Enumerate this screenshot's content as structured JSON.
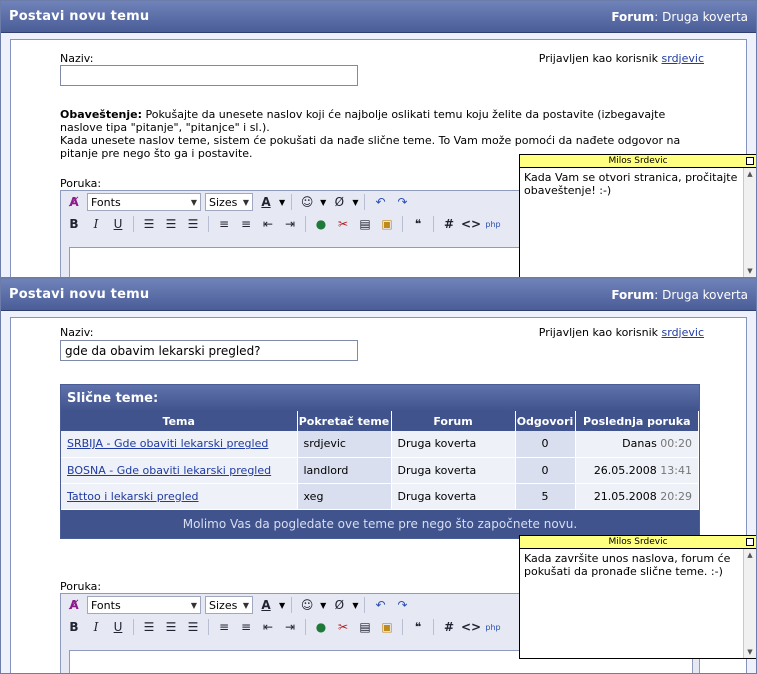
{
  "panel1": {
    "title": "Postavi novu temu",
    "crumb_label": "Forum",
    "crumb_value": ": Druga koverta",
    "name_label": "Naziv:",
    "name_value": "",
    "logged_text": "Prijavljen kao korisnik",
    "username": "srdjevic",
    "notice_bold": "Obaveštenje:",
    "notice_text": " Pokušajte da unesete naslov koji će najbolje oslikati temu koju želite da postavite (izbegavajte naslove tipa \"pitanje\", \"pitanjce\" i sl.).",
    "notice_text2": "Kada unesete naslov teme, sistem će pokušati da nađe slične teme. To Vam može pomoći da nađete odgovor na pitanje pre nego što ga i postavite.",
    "message_label": "Poruka:",
    "note": {
      "author": "Milos Srdevic",
      "text": "Kada Vam se otvori stranica, pročitajte obaveštenje! :-)"
    }
  },
  "panel2": {
    "title": "Postavi novu temu",
    "crumb_label": "Forum",
    "crumb_value": ": Druga koverta",
    "name_label": "Naziv:",
    "name_value": "gde da obavim lekarski pregled?",
    "logged_text": "Prijavljen kao korisnik",
    "username": "srdjevic",
    "similar": {
      "title": "Slične teme:",
      "columns": [
        "Tema",
        "Pokretač teme",
        "Forum",
        "Odgovori",
        "Poslednja poruka"
      ],
      "rows": [
        {
          "topic": "SRBIJA - Gde obaviti lekarski pregled",
          "starter": "srdjevic",
          "forum": "Druga koverta",
          "replies": "0",
          "date": "Danas",
          "time": "00:20"
        },
        {
          "topic": "BOSNA - Gde obaviti lekarski pregled",
          "starter": "landlord",
          "forum": "Druga koverta",
          "replies": "0",
          "date": "26.05.2008",
          "time": "13:41"
        },
        {
          "topic": "Tattoo i lekarski pregled",
          "starter": "xeg",
          "forum": "Druga koverta",
          "replies": "5",
          "date": "21.05.2008",
          "time": "20:29"
        }
      ],
      "footer": "Molimo Vas da pogledate ove teme pre nego što započnete novu."
    },
    "message_label": "Poruka:",
    "note": {
      "author": "Milos Srdevic",
      "text": "Kada završite unos naslova, forum će pokušati da pronađe slične teme. :-)"
    }
  },
  "toolbar": {
    "fonts": "Fonts",
    "sizes": "Sizes",
    "hash": "#",
    "code": "<>"
  }
}
